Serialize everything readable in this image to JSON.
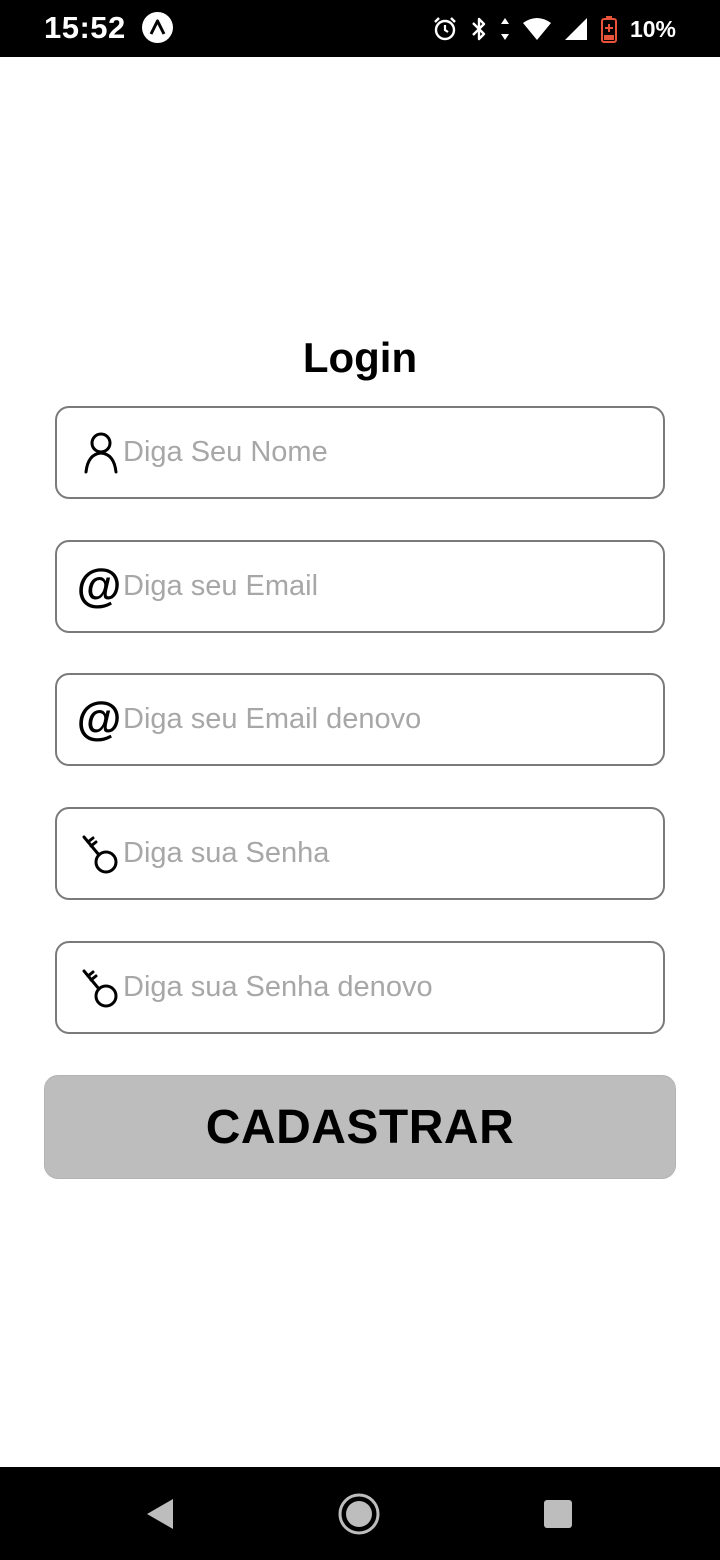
{
  "status_bar": {
    "time": "15:52",
    "battery_percent": "10%",
    "icons": [
      "app-badge-icon",
      "alarm-icon",
      "bluetooth-icon",
      "data-arrows-icon",
      "wifi-icon",
      "signal-icon",
      "battery-low-icon"
    ]
  },
  "screen": {
    "title": "Login",
    "fields": {
      "name": {
        "placeholder": "Diga Seu Nome",
        "value": "",
        "icon": "user-icon"
      },
      "email": {
        "placeholder": "Diga seu Email",
        "value": "",
        "icon": "at-icon"
      },
      "email_confirm": {
        "placeholder": "Diga seu Email denovo",
        "value": "",
        "icon": "at-icon"
      },
      "password": {
        "placeholder": "Diga sua Senha",
        "value": "",
        "icon": "key-icon"
      },
      "password_confirm": {
        "placeholder": "Diga sua Senha denovo",
        "value": "",
        "icon": "key-icon"
      }
    },
    "at_symbol": "@",
    "submit_label": "CADASTRAR"
  },
  "nav_bar": {
    "buttons": [
      "back-icon",
      "home-icon",
      "recent-apps-icon"
    ]
  },
  "colors": {
    "status_bar_bg": "#000000",
    "field_border": "#7a7a7a",
    "placeholder": "#a7a7a7",
    "button_bg": "#bdbdbd",
    "battery_low": "#e8543a"
  }
}
